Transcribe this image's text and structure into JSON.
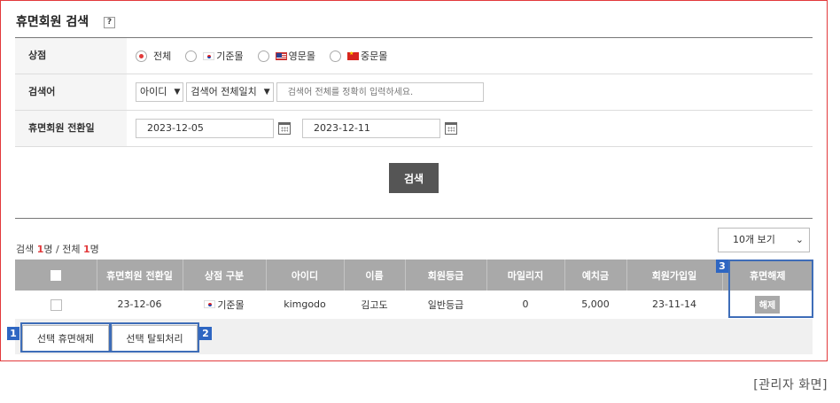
{
  "page": {
    "title": "휴면회원 검색",
    "help_label": "?"
  },
  "search": {
    "store_label": "상점",
    "store_options": [
      {
        "label": "전체",
        "flag": "",
        "selected": true
      },
      {
        "label": "기준몰",
        "flag": "kr-flag",
        "selected": false
      },
      {
        "label": "영문몰",
        "flag": "us-flag",
        "selected": false
      },
      {
        "label": "중문몰",
        "flag": "cn-flag",
        "selected": false
      }
    ],
    "keyword_label": "검색어",
    "keyword_field": "아이디",
    "keyword_match": "검색어 전체일치",
    "keyword_placeholder": "검색어 전체를 정확히 입력하세요.",
    "date_label": "휴면회원 전환일",
    "date_from": "2023-12-05",
    "date_to": "2023-12-11",
    "button": "검색"
  },
  "results": {
    "prefix": "검색 ",
    "found": "1",
    "mid": "명 / 전체 ",
    "total": "1",
    "suffix": "명",
    "per_page": "10개 보기"
  },
  "table": {
    "headers": [
      "휴면회원 전환일",
      "상점 구분",
      "아이디",
      "이름",
      "회원등급",
      "마일리지",
      "예치금",
      "회원가입일",
      "휴면해제"
    ],
    "rows": [
      {
        "date": "23-12-06",
        "store": "기준몰",
        "id": "kimgodo",
        "name": "김고도",
        "grade": "일반등급",
        "mileage": "0",
        "deposit": "5,000",
        "joined": "23-11-14",
        "action": "해제"
      }
    ]
  },
  "actions": {
    "release_selected": "선택 휴면해제",
    "withdraw_selected": "선택 탈퇴처리"
  },
  "badges": [
    "1",
    "2",
    "3"
  ],
  "caption": "[관리자 화면]",
  "colors": {
    "accent": "#e2393b",
    "highlight": "#2e66c2",
    "header_bg": "#a9a9a9"
  }
}
